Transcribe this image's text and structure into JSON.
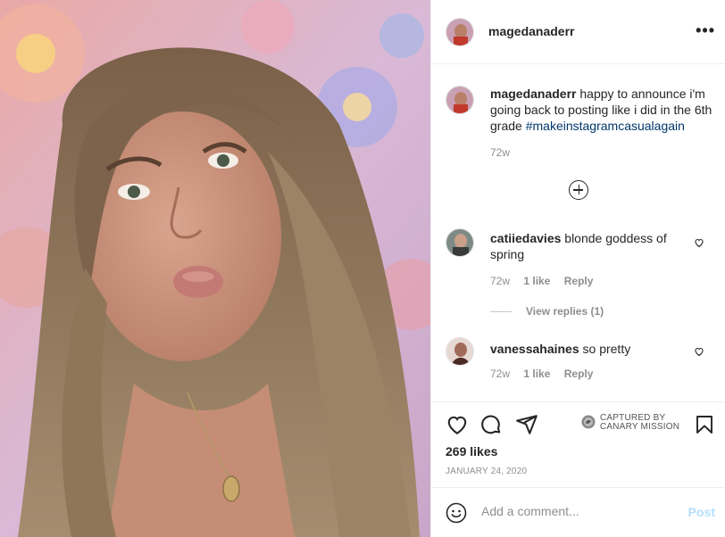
{
  "post": {
    "username": "magedanaderr",
    "more_label": "•••",
    "caption_text": "happy to announce i'm going back to posting like i did in the 6th grade",
    "hashtag": "#makeinstagramcasualagain",
    "caption_time": "72w",
    "likes": "269 likes",
    "date": "January 24, 2020"
  },
  "comments": [
    {
      "username": "catiiedavies",
      "text": "blonde goddess of spring",
      "time": "72w",
      "likes": "1 like",
      "reply": "Reply",
      "view_replies": "View replies (1)"
    },
    {
      "username": "vanessahaines",
      "text": "so pretty",
      "time": "72w",
      "likes": "1 like",
      "reply": "Reply"
    }
  ],
  "watermark": {
    "line1": "CAPTURED BY",
    "line2": "CANARY MISSION"
  },
  "composer": {
    "placeholder": "Add a comment...",
    "post_label": "Post"
  },
  "icons": [
    "heart-icon",
    "comment-icon",
    "share-icon",
    "bookmark-icon",
    "emoji-icon",
    "load-more-icon",
    "more-icon"
  ],
  "colors": {
    "hashtag": "#00376b",
    "muted": "#8e8e8e",
    "post_disabled": "#b2dffc",
    "border": "#efefef"
  }
}
